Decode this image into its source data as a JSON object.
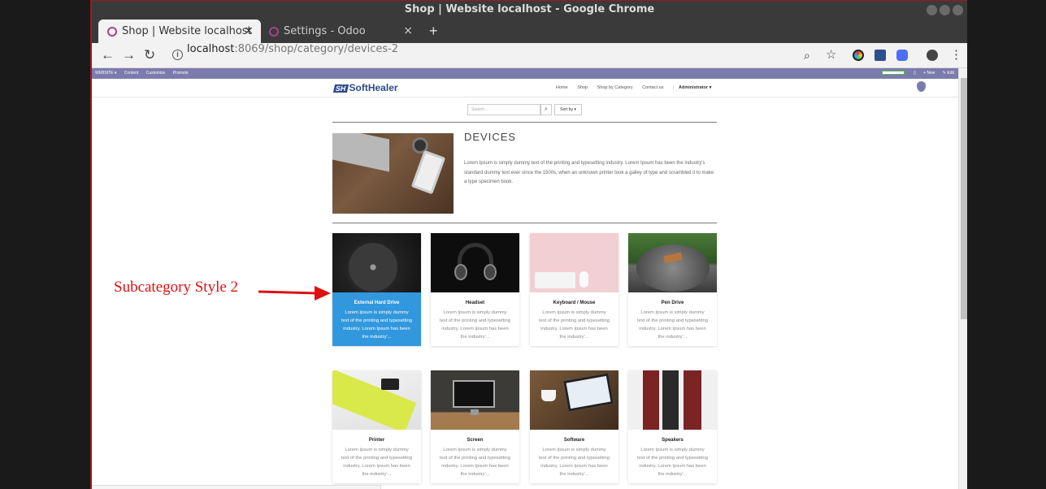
{
  "window": {
    "title": "Shop | Website localhost - Google Chrome"
  },
  "tabs": [
    {
      "label": "Shop | Website localhost",
      "close": "×"
    },
    {
      "label": "Settings - Odoo",
      "close": "×"
    }
  ],
  "new_tab": "+",
  "address": {
    "host": "localhost",
    "path": ":8069/shop/category/devices-2",
    "info_glyph": "i"
  },
  "toolbar_icons": [
    "back-icon",
    "forward-icon",
    "reload-icon",
    "zoom-icon",
    "star-icon",
    "profile-icon",
    "menu-icon"
  ],
  "odoo_bar": {
    "items": [
      "WEBSITE ▾",
      "Content",
      "Customize",
      "Promote"
    ],
    "new_label": "+ New",
    "edit_label": "✎ Edit"
  },
  "site": {
    "logo_mark": "SH",
    "logo_text": "SoftHealer",
    "menu": [
      "Home",
      "Shop",
      "Shop by Category",
      "Contact us"
    ],
    "admin": "Administrator ▾"
  },
  "search": {
    "placeholder": "Search...",
    "sort_label": "Sort by ▾"
  },
  "category": {
    "title": "DEVICES",
    "description": "Lorem Ipsum is simply dummy text of the printing and typesetting industry. Lorem Ipsum has been the industry's standard dummy text ever since the 1500s, when an unknown printer took a galley of type and scrambled it to make a type specimen book."
  },
  "subcategories": [
    {
      "name": "External Hard Drive",
      "text": "Lorem Ipsum is simply dummy text of the printing and typesetting industry. Lorem Ipsum has been the industry'..."
    },
    {
      "name": "Headset",
      "text": "Lorem Ipsum is simply dummy text of the printing and typesetting industry. Lorem Ipsum has been the industry'..."
    },
    {
      "name": "Keyboard / Mouse",
      "text": "Lorem Ipsum is simply dummy text of the printing and typesetting industry. Lorem Ipsum has been the industry'..."
    },
    {
      "name": "Pen Drive",
      "text": "Lorem Ipsum is simply dummy text of the printing and typesetting industry. Lorem Ipsum has been the industry'..."
    },
    {
      "name": "Printer",
      "text": "Lorem Ipsum is simply dummy text of the printing and typesetting industry. Lorem Ipsum has been the industry'..."
    },
    {
      "name": "Screen",
      "text": "Lorem Ipsum is simply dummy text of the printing and typesetting industry. Lorem Ipsum has been the industry'..."
    },
    {
      "name": "Software",
      "text": "Lorem Ipsum is simply dummy text of the printing and typesetting industry. Lorem Ipsum has been the industry'..."
    },
    {
      "name": "Speakers",
      "text": "Lorem Ipsum is simply dummy text of the printing and typesetting industry. Lorem Ipsum has been the industry'..."
    }
  ],
  "annotation": "Subcategory Style 2",
  "colors": {
    "odoo_purple": "#7c7bad",
    "active_card": "#3298dd",
    "annotation": "#e01010"
  }
}
